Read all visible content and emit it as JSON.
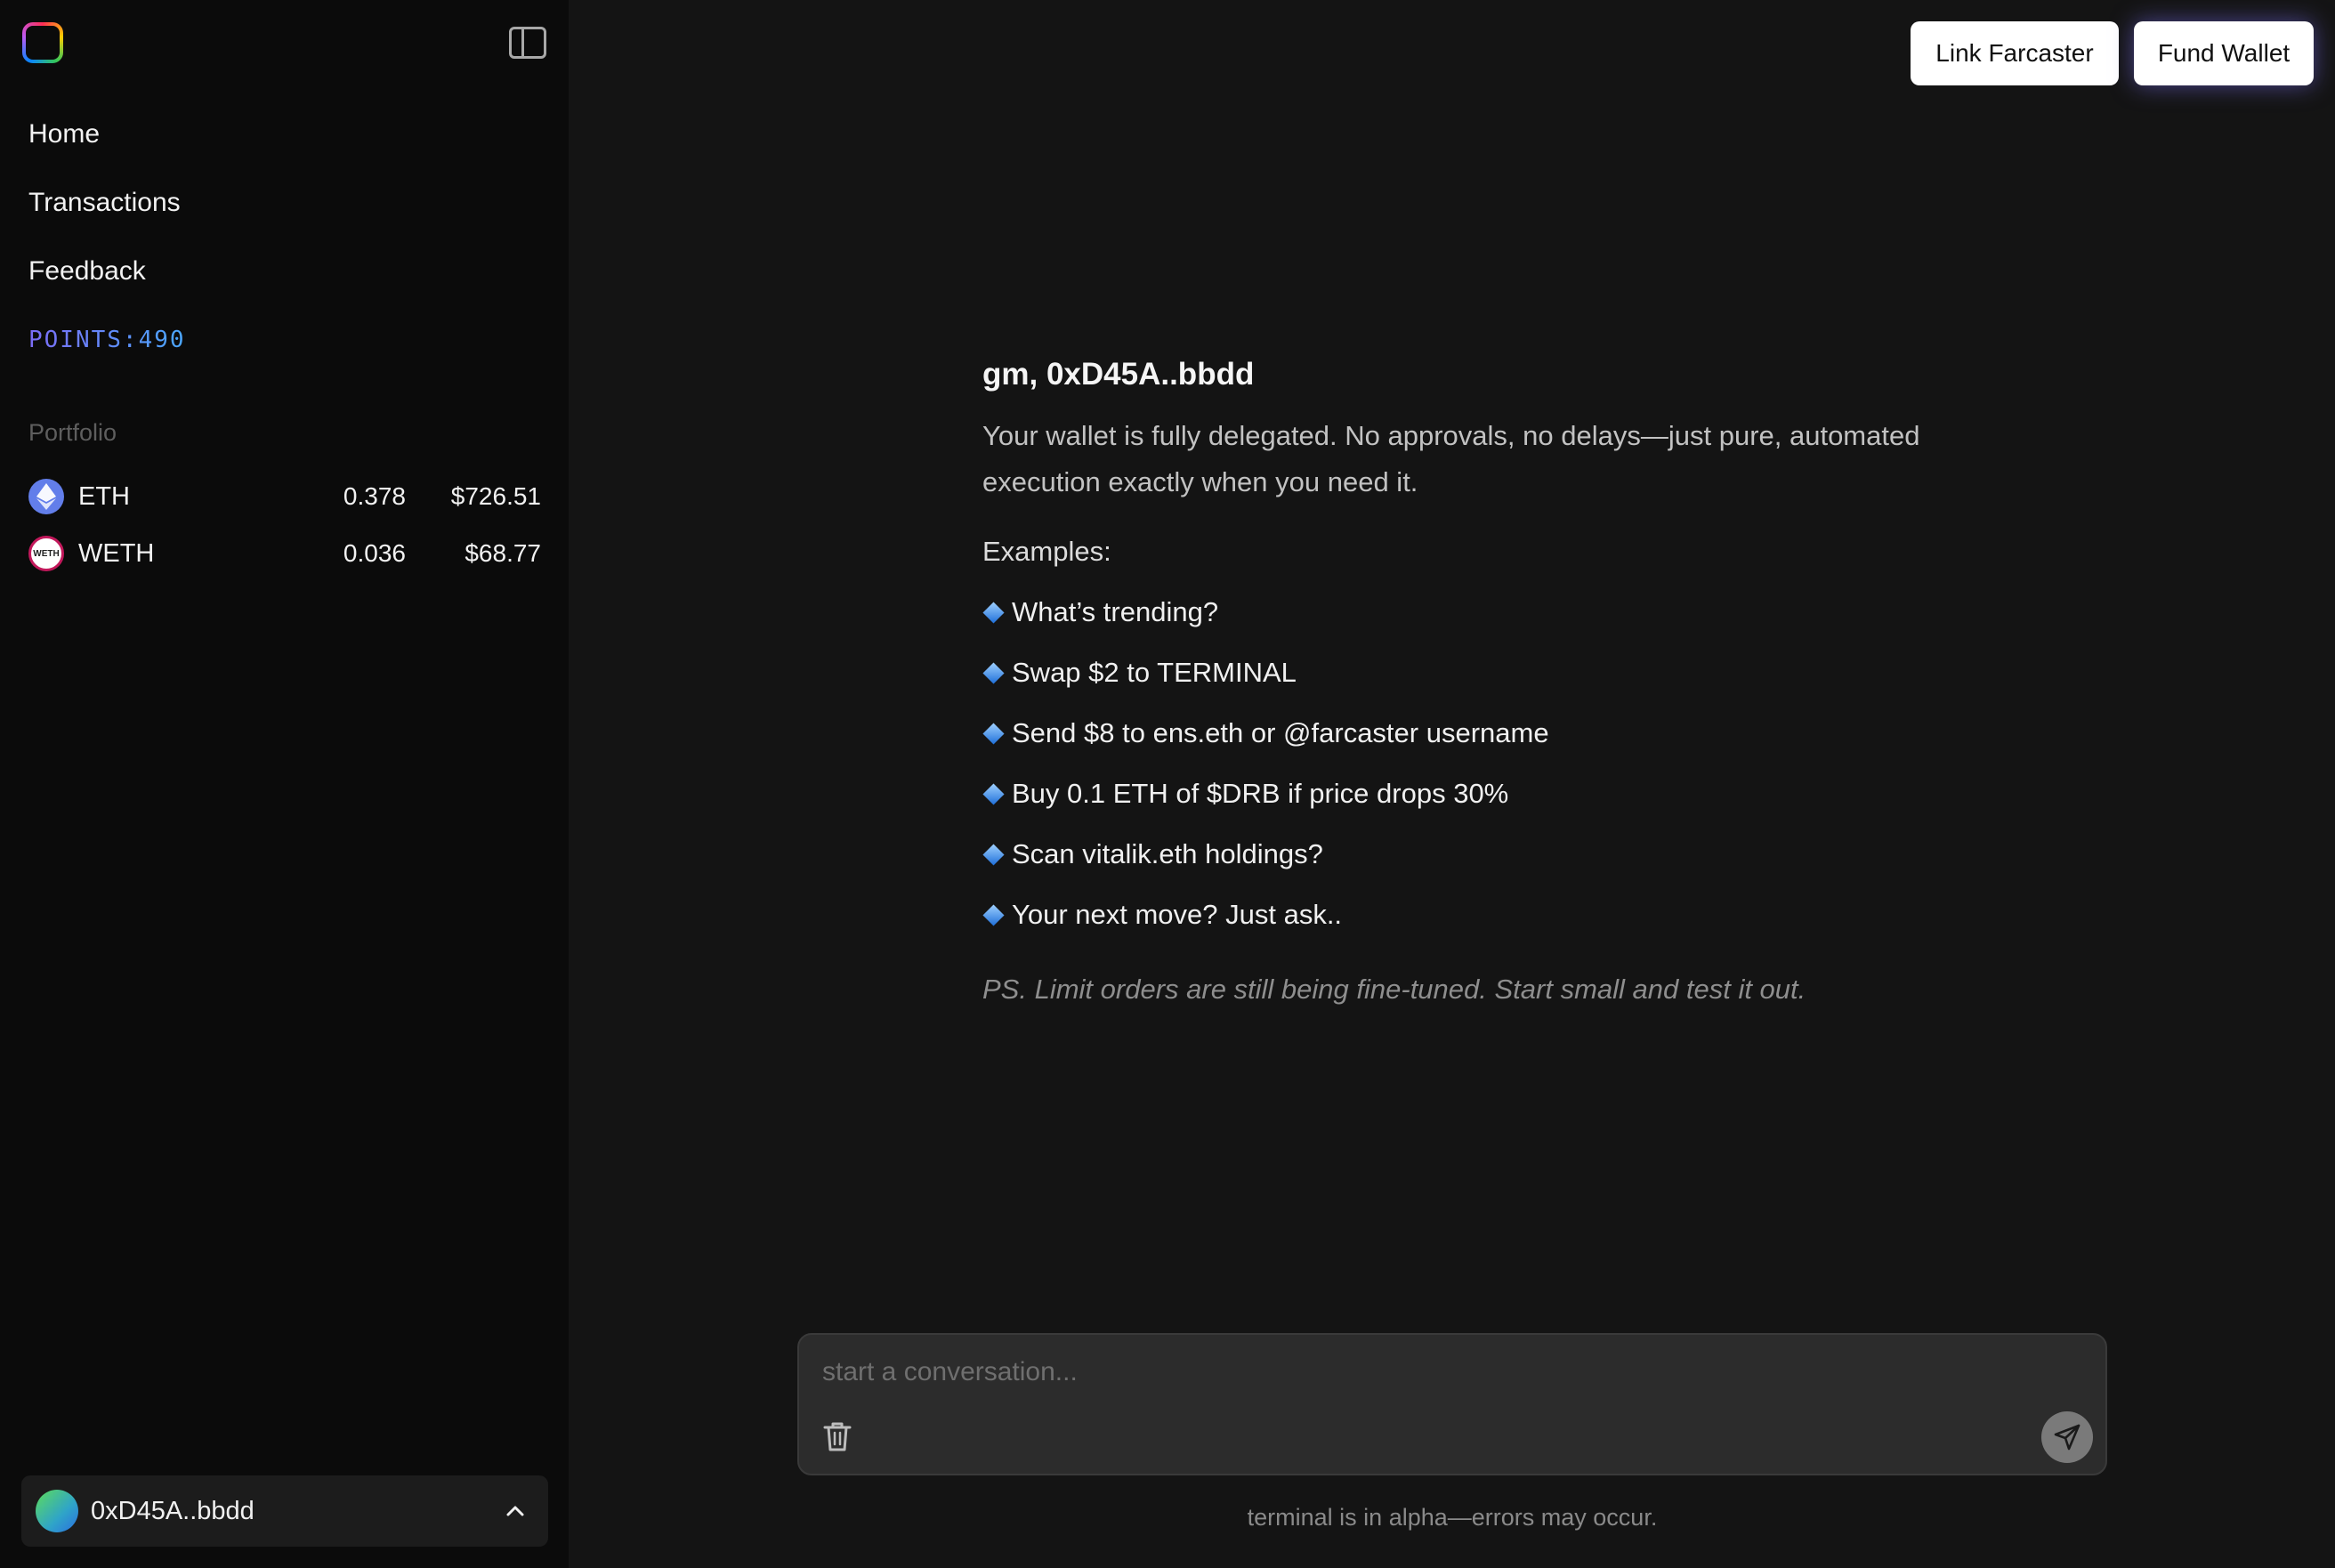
{
  "sidebar": {
    "nav": [
      {
        "label": "Home"
      },
      {
        "label": "Transactions"
      },
      {
        "label": "Feedback"
      }
    ],
    "points_label": "POINTS:490",
    "portfolio_title": "Portfolio",
    "assets": [
      {
        "symbol": "ETH",
        "icon": "eth-icon",
        "amount": "0.378",
        "value": "$726.51"
      },
      {
        "symbol": "WETH",
        "icon_text": "WETH",
        "amount": "0.036",
        "value": "$68.77"
      }
    ],
    "account": {
      "address": "0xD45A..bbdd"
    }
  },
  "header": {
    "link_farcaster": "Link Farcaster",
    "fund_wallet": "Fund Wallet"
  },
  "main": {
    "greeting": "gm, 0xD45A..bbdd",
    "intro": "Your wallet is fully delegated. No approvals, no delays—just pure, automated execution exactly when you need it.",
    "examples_title": "Examples:",
    "examples": [
      "What’s trending?",
      "Swap $2 to TERMINAL",
      "Send $8 to ens.eth or @farcaster username",
      "Buy 0.1 ETH of $DRB if price drops 30%",
      "Scan vitalik.eth holdings?",
      "Your next move? Just ask.."
    ],
    "ps": "PS. Limit orders are still being fine-tuned. Start small and test it out."
  },
  "chat": {
    "placeholder": "start a conversation...",
    "value": ""
  },
  "footer": {
    "note": "terminal is in alpha—errors may occur."
  },
  "colors": {
    "background": "#141414",
    "sidebar": "#0b0b0b",
    "chat_box": "#2c2c2c",
    "points_gradient": [
      "#7b6cf6",
      "#4aa8ff"
    ],
    "eth": "#627eea"
  }
}
